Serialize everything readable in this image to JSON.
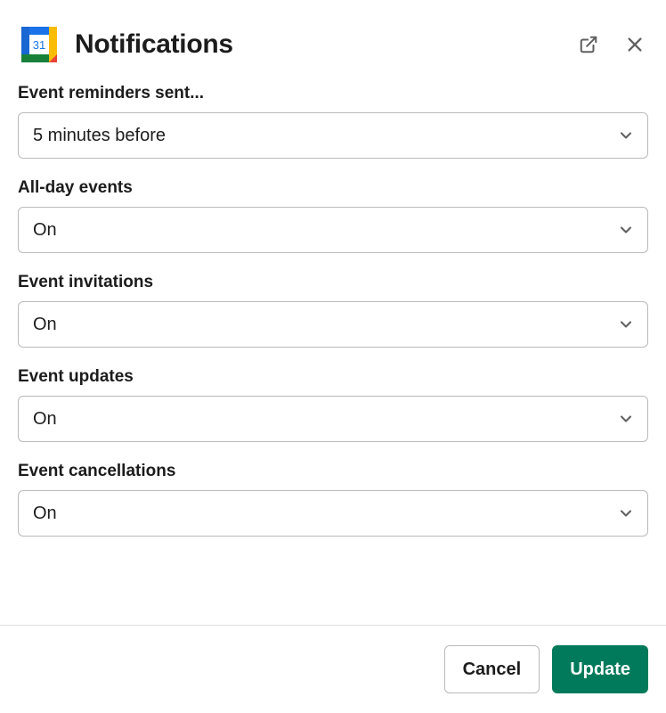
{
  "header": {
    "title": "Notifications"
  },
  "fields": {
    "reminders": {
      "label": "Event reminders sent...",
      "value": "5 minutes before"
    },
    "all_day": {
      "label": "All-day events",
      "value": "On"
    },
    "invitations": {
      "label": "Event invitations",
      "value": "On"
    },
    "updates": {
      "label": "Event updates",
      "value": "On"
    },
    "cancellations": {
      "label": "Event cancellations",
      "value": "On"
    }
  },
  "footer": {
    "cancel_label": "Cancel",
    "update_label": "Update"
  },
  "icons": {
    "calendar_day": "31"
  }
}
